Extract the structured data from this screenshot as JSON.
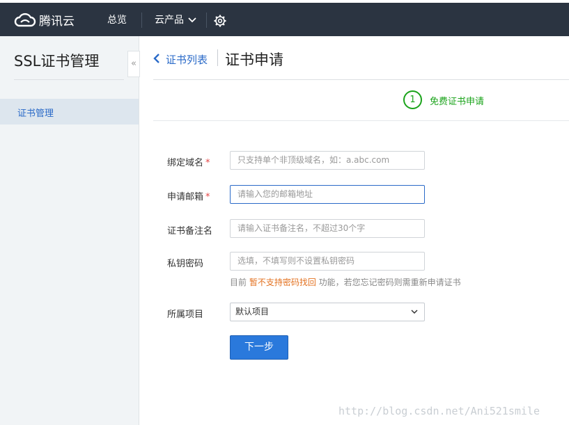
{
  "topbar": {
    "logo_text": "腾讯云",
    "nav": [
      "总览",
      "云产品"
    ]
  },
  "sidebar": {
    "title": "SSL证书管理",
    "items": [
      {
        "label": "证书管理"
      }
    ],
    "collapse_glyph": "«"
  },
  "header": {
    "back_link": "证书列表",
    "title": "证书申请"
  },
  "steps": [
    {
      "number": "1",
      "label": "免费证书申请"
    }
  ],
  "form": {
    "domain": {
      "label": "绑定域名",
      "required": "*",
      "placeholder": "只支持单个非顶级域名，如：a.abc.com"
    },
    "email": {
      "label": "申请邮箱",
      "required": "*",
      "placeholder": "请输入您的邮箱地址"
    },
    "remark": {
      "label": "证书备注名",
      "placeholder": "请输入证书备注名，不超过30个字"
    },
    "password": {
      "label": "私钥密码",
      "placeholder": "选填，不填写则不设置私钥密码"
    },
    "password_hint": {
      "prefix": "目前 ",
      "warning": "暂不支持密码找回",
      "suffix": " 功能，若您忘记密码则需重新申请证书"
    },
    "project": {
      "label": "所属项目",
      "value": "默认项目"
    },
    "submit_label": "下一步"
  },
  "watermark": "http://blog.csdn.net/Ani521smile",
  "colors": {
    "topbar": "#2b3441",
    "accent": "#2a6ac8",
    "step": "#1aa31a",
    "button": "#2a79dc",
    "warning": "#e37221",
    "required": "#e54545"
  }
}
